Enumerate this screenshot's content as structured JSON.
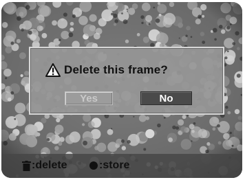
{
  "dialog": {
    "message": "Delete this frame?",
    "icon": "warning-icon",
    "yes_label": "Yes",
    "no_label": "No",
    "selected": "No"
  },
  "bottom_bar": {
    "delete_hint": ":delete",
    "delete_icon": "trash-icon",
    "store_hint": ":store",
    "store_icon": "dot-icon"
  },
  "colors": {
    "dialog_bg": "#969696",
    "selected_button": "#4a4a4a",
    "unselected_button": "#9c9c9c"
  }
}
